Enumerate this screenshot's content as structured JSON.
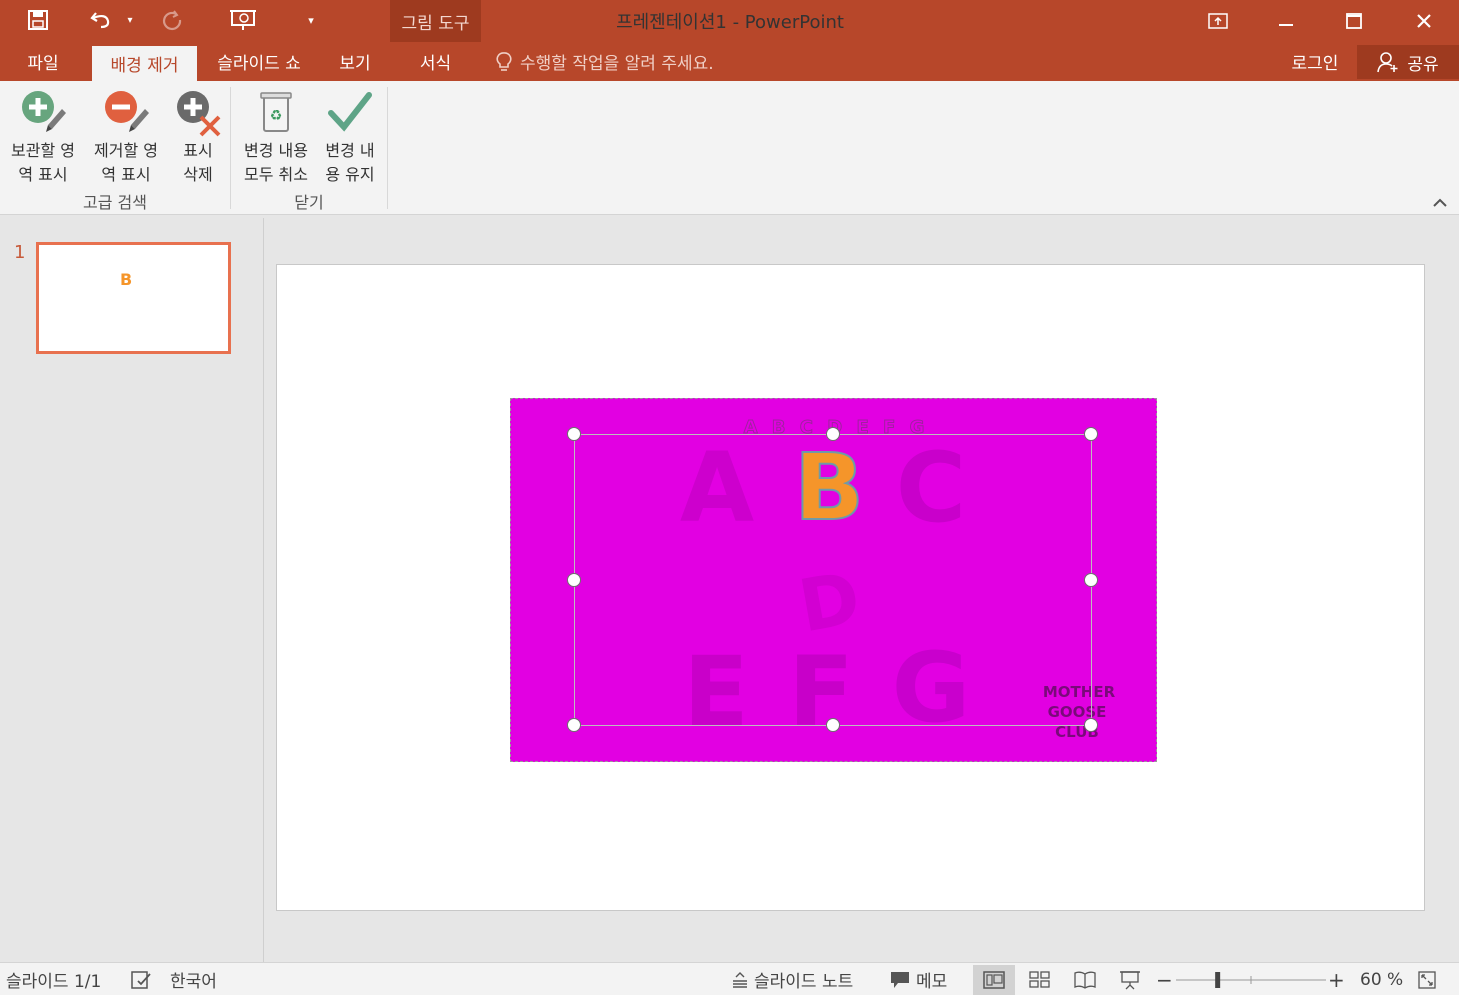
{
  "app": {
    "document_title": "프레젠테이션1 - PowerPoint",
    "context_group": "그림 도구"
  },
  "tabs": [
    {
      "label": "파일"
    },
    {
      "label": "배경 제거",
      "active": true
    },
    {
      "label": "슬라이드 쇼"
    },
    {
      "label": "보기"
    },
    {
      "label": "서식"
    }
  ],
  "tellme": {
    "placeholder": "수행할 작업을 알려 주세요."
  },
  "account": {
    "signin": "로그인",
    "share": "공유"
  },
  "ribbon": {
    "groups": [
      {
        "label": "고급 검색",
        "buttons": [
          {
            "label": "보관할 영\n역 표시",
            "icon": "mark-keep-icon"
          },
          {
            "label": "제거할 영\n역 표시",
            "icon": "mark-remove-icon"
          },
          {
            "label": "표시\n삭제",
            "icon": "delete-mark-icon"
          }
        ]
      },
      {
        "label": "닫기",
        "buttons": [
          {
            "label": "변경 내용\n모두 취소",
            "icon": "discard-changes-icon"
          },
          {
            "label": "변경 내\n용 유지",
            "icon": "keep-changes-icon"
          }
        ]
      }
    ]
  },
  "thumbnails": [
    {
      "number": "1",
      "preview_text": "B"
    }
  ],
  "status": {
    "slide_count": "슬라이드 1/1",
    "language": "한국어",
    "notes": "슬라이드 노트",
    "comments": "메모",
    "zoom": "60 %",
    "zoom_percent": 60
  },
  "colors": {
    "accent": "#b7472a",
    "removal_overlay": "#e200e2",
    "kept_region": "#f5952a"
  }
}
